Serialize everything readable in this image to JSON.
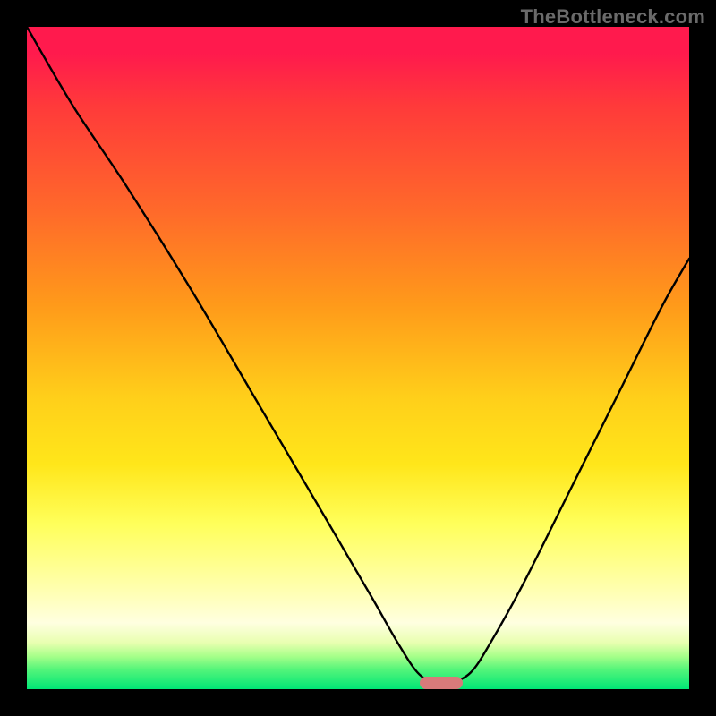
{
  "watermark": "TheBottleneck.com",
  "chart_data": {
    "type": "line",
    "title": "",
    "xlabel": "",
    "ylabel": "",
    "xlim": [
      0,
      100
    ],
    "ylim": [
      0,
      100
    ],
    "grid": false,
    "legend": "none",
    "series": [
      {
        "name": "bottleneck-curve",
        "x": [
          0,
          7,
          15,
          25,
          35,
          45,
          52,
          56,
          59,
          61.5,
          64,
          67,
          70,
          75,
          82,
          90,
          96,
          100
        ],
        "y": [
          100,
          88,
          76,
          60,
          43,
          26,
          14,
          7,
          2.5,
          1,
          1,
          2.5,
          7,
          16,
          30,
          46,
          58,
          65
        ]
      }
    ],
    "marker": {
      "x": 62.5,
      "y": 1,
      "color": "#d87a7a"
    },
    "background_gradient": {
      "top": "#ff1a4d",
      "bottom": "#00e676"
    }
  }
}
